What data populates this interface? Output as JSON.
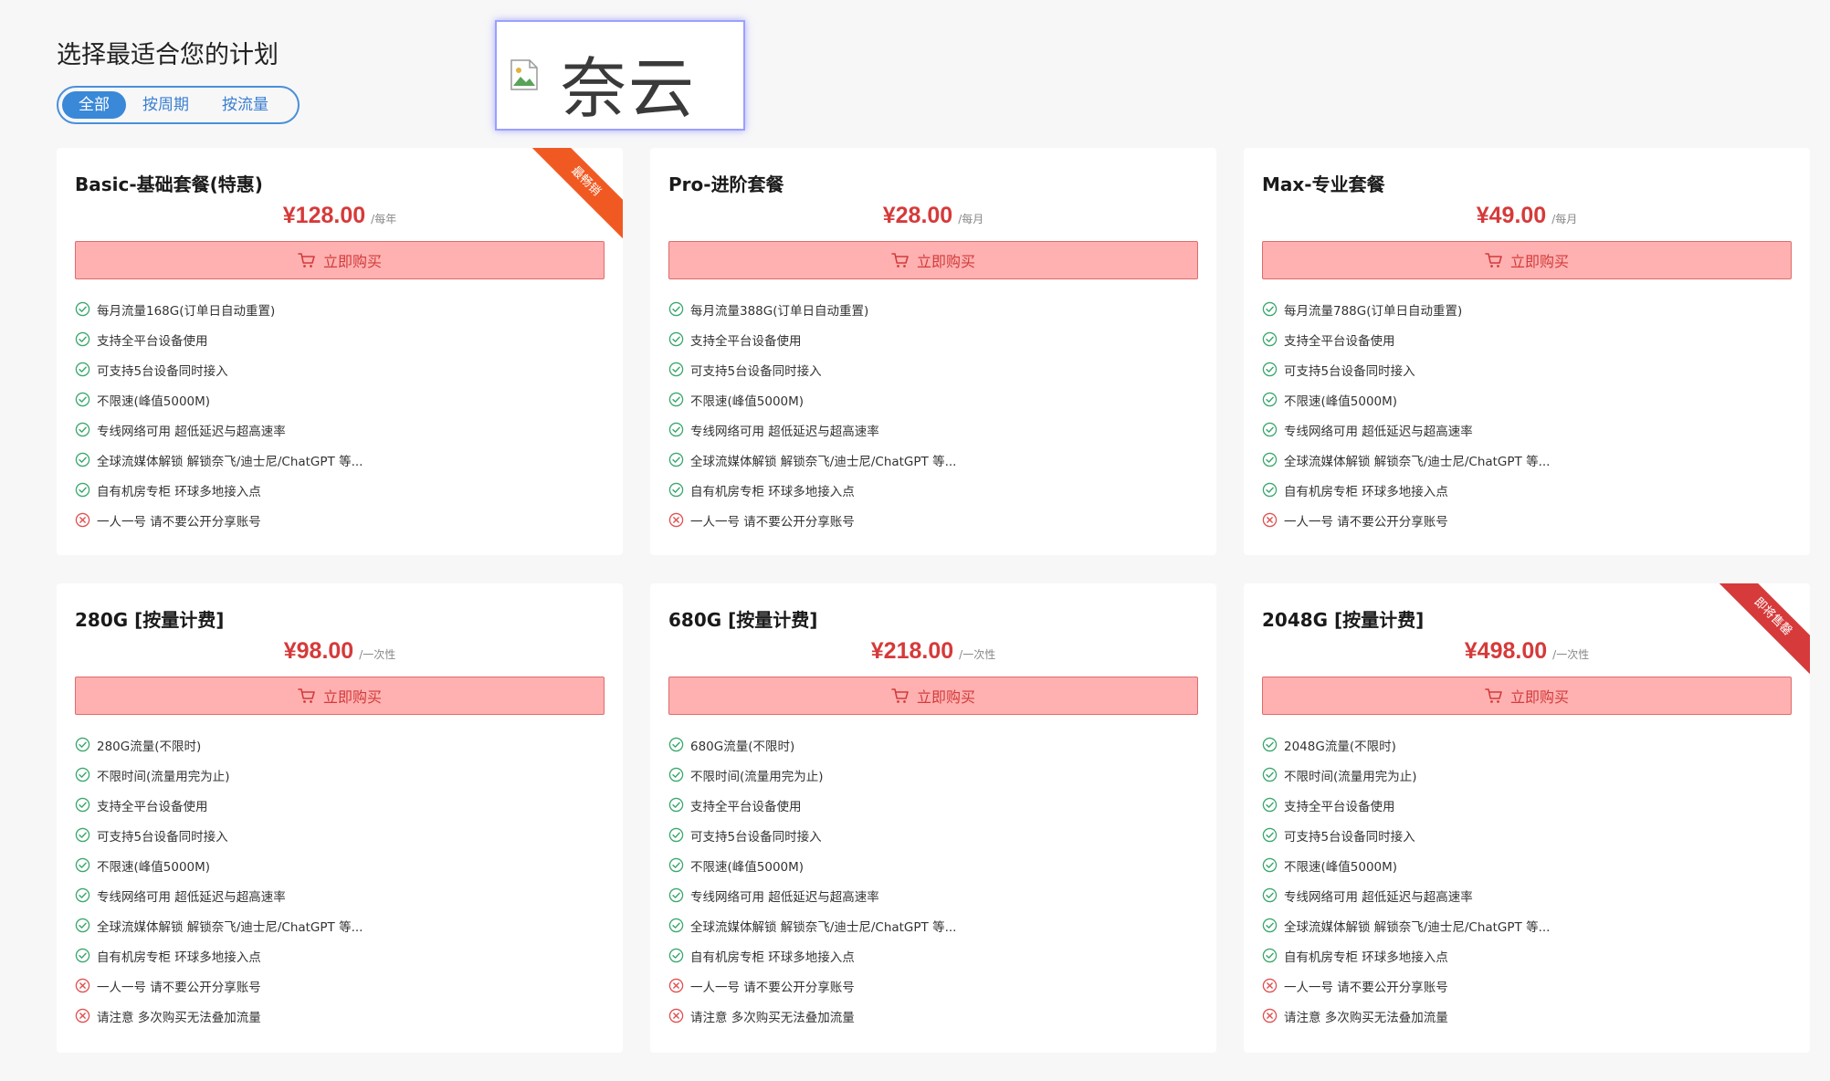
{
  "page": {
    "title": "选择最适合您的计划",
    "filters": [
      {
        "label": "全部",
        "active": true
      },
      {
        "label": "按周期",
        "active": false
      },
      {
        "label": "按流量",
        "active": false
      }
    ],
    "logo_text": "奈云"
  },
  "button_label": "立即购买",
  "colors": {
    "accent_blue": "#3a88d8",
    "price_red": "#d63a3a",
    "button_bg": "#ffb1b1",
    "check_green": "#3aa76d",
    "cross_red": "#e05050",
    "ribbon_orange": "#f05a22",
    "ribbon_red": "#d63a3a"
  },
  "plans": [
    {
      "name": "Basic-基础套餐(特惠)",
      "price": "¥128.00",
      "period": "/每年",
      "ribbon": {
        "text": "最畅销",
        "color": "#f05a22"
      },
      "features": [
        {
          "text": "每月流量168G(订单日自动重置)",
          "ok": true
        },
        {
          "text": "支持全平台设备使用",
          "ok": true
        },
        {
          "text": "可支持5台设备同时接入",
          "ok": true
        },
        {
          "text": "不限速(峰值5000M)",
          "ok": true
        },
        {
          "text": "专线网络可用 超低延迟与超高速率",
          "ok": true
        },
        {
          "text": "全球流媒体解锁 解锁奈飞/迪士尼/ChatGPT 等...",
          "ok": true
        },
        {
          "text": "自有机房专柜 环球多地接入点",
          "ok": true
        },
        {
          "text": "一人一号 请不要公开分享账号",
          "ok": false
        }
      ]
    },
    {
      "name": "Pro-进阶套餐",
      "price": "¥28.00",
      "period": "/每月",
      "features": [
        {
          "text": "每月流量388G(订单日自动重置)",
          "ok": true
        },
        {
          "text": "支持全平台设备使用",
          "ok": true
        },
        {
          "text": "可支持5台设备同时接入",
          "ok": true
        },
        {
          "text": "不限速(峰值5000M)",
          "ok": true
        },
        {
          "text": "专线网络可用 超低延迟与超高速率",
          "ok": true
        },
        {
          "text": "全球流媒体解锁 解锁奈飞/迪士尼/ChatGPT 等...",
          "ok": true
        },
        {
          "text": "自有机房专柜 环球多地接入点",
          "ok": true
        },
        {
          "text": "一人一号 请不要公开分享账号",
          "ok": false
        }
      ]
    },
    {
      "name": "Max-专业套餐",
      "price": "¥49.00",
      "period": "/每月",
      "features": [
        {
          "text": "每月流量788G(订单日自动重置)",
          "ok": true
        },
        {
          "text": "支持全平台设备使用",
          "ok": true
        },
        {
          "text": "可支持5台设备同时接入",
          "ok": true
        },
        {
          "text": "不限速(峰值5000M)",
          "ok": true
        },
        {
          "text": "专线网络可用 超低延迟与超高速率",
          "ok": true
        },
        {
          "text": "全球流媒体解锁 解锁奈飞/迪士尼/ChatGPT 等...",
          "ok": true
        },
        {
          "text": "自有机房专柜 环球多地接入点",
          "ok": true
        },
        {
          "text": "一人一号 请不要公开分享账号",
          "ok": false
        }
      ]
    },
    {
      "name": "280G [按量计费]",
      "price": "¥98.00",
      "period": "/一次性",
      "features": [
        {
          "text": "280G流量(不限时)",
          "ok": true
        },
        {
          "text": "不限时间(流量用完为止)",
          "ok": true
        },
        {
          "text": "支持全平台设备使用",
          "ok": true
        },
        {
          "text": "可支持5台设备同时接入",
          "ok": true
        },
        {
          "text": "不限速(峰值5000M)",
          "ok": true
        },
        {
          "text": "专线网络可用 超低延迟与超高速率",
          "ok": true
        },
        {
          "text": "全球流媒体解锁 解锁奈飞/迪士尼/ChatGPT 等...",
          "ok": true
        },
        {
          "text": "自有机房专柜 环球多地接入点",
          "ok": true
        },
        {
          "text": "一人一号 请不要公开分享账号",
          "ok": false
        },
        {
          "text": "请注意 多次购买无法叠加流量",
          "ok": false
        }
      ]
    },
    {
      "name": "680G [按量计费]",
      "price": "¥218.00",
      "period": "/一次性",
      "features": [
        {
          "text": "680G流量(不限时)",
          "ok": true
        },
        {
          "text": "不限时间(流量用完为止)",
          "ok": true
        },
        {
          "text": "支持全平台设备使用",
          "ok": true
        },
        {
          "text": "可支持5台设备同时接入",
          "ok": true
        },
        {
          "text": "不限速(峰值5000M)",
          "ok": true
        },
        {
          "text": "专线网络可用 超低延迟与超高速率",
          "ok": true
        },
        {
          "text": "全球流媒体解锁 解锁奈飞/迪士尼/ChatGPT 等...",
          "ok": true
        },
        {
          "text": "自有机房专柜 环球多地接入点",
          "ok": true
        },
        {
          "text": "一人一号 请不要公开分享账号",
          "ok": false
        },
        {
          "text": "请注意 多次购买无法叠加流量",
          "ok": false
        }
      ]
    },
    {
      "name": "2048G [按量计费]",
      "price": "¥498.00",
      "period": "/一次性",
      "ribbon": {
        "text": "即将售罄",
        "color": "#d63a3a"
      },
      "features": [
        {
          "text": "2048G流量(不限时)",
          "ok": true
        },
        {
          "text": "不限时间(流量用完为止)",
          "ok": true
        },
        {
          "text": "支持全平台设备使用",
          "ok": true
        },
        {
          "text": "可支持5台设备同时接入",
          "ok": true
        },
        {
          "text": "不限速(峰值5000M)",
          "ok": true
        },
        {
          "text": "专线网络可用 超低延迟与超高速率",
          "ok": true
        },
        {
          "text": "全球流媒体解锁 解锁奈飞/迪士尼/ChatGPT 等...",
          "ok": true
        },
        {
          "text": "自有机房专柜 环球多地接入点",
          "ok": true
        },
        {
          "text": "一人一号 请不要公开分享账号",
          "ok": false
        },
        {
          "text": "请注意 多次购买无法叠加流量",
          "ok": false
        }
      ]
    }
  ]
}
